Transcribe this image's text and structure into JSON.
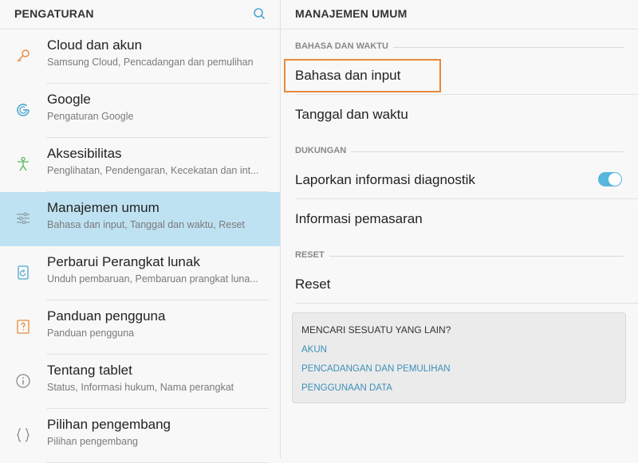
{
  "left_panel": {
    "title": "PENGATURAN",
    "search_icon": "search-icon",
    "items": [
      {
        "label": "Cloud dan akun",
        "sub": "Samsung Cloud, Pencadangan dan pemulihan",
        "icon": "key-icon"
      },
      {
        "label": "Google",
        "sub": "Pengaturan Google",
        "icon": "google-icon"
      },
      {
        "label": "Aksesibilitas",
        "sub": "Penglihatan, Pendengaran, Kecekatan dan int...",
        "icon": "accessibility-icon"
      },
      {
        "label": "Manajemen umum",
        "sub": "Bahasa dan input, Tanggal dan waktu, Reset",
        "icon": "sliders-icon",
        "active": true
      },
      {
        "label": "Perbarui Perangkat lunak",
        "sub": "Unduh pembaruan, Pembaruan prangkat luna...",
        "icon": "software-update-icon"
      },
      {
        "label": "Panduan pengguna",
        "sub": "Panduan pengguna",
        "icon": "help-book-icon"
      },
      {
        "label": "Tentang tablet",
        "sub": "Status, Informasi hukum, Nama perangkat",
        "icon": "info-icon"
      },
      {
        "label": "Pilihan pengembang",
        "sub": "Pilihan pengembang",
        "icon": "braces-icon"
      }
    ]
  },
  "right_panel": {
    "title": "MANAJEMEN UMUM",
    "sections": {
      "language_time": "BAHASA DAN WAKTU",
      "support": "DUKUNGAN",
      "reset": "RESET"
    },
    "items": {
      "language_input": "Bahasa dan input",
      "date_time": "Tanggal dan waktu",
      "report_diagnostic": "Laporkan informasi diagnostik",
      "marketing_info": "Informasi pemasaran",
      "reset": "Reset"
    },
    "diagnostic_toggle_on": true,
    "suggest_box": {
      "question": "MENCARI SESUATU YANG LAIN?",
      "links": [
        "AKUN",
        "PENCADANGAN DAN PEMULIHAN",
        "PENGGUNAAN DATA"
      ]
    }
  },
  "colors": {
    "accent": "#57b6dc",
    "active_bg": "#bfe2f2",
    "highlight": "#e8893a",
    "link": "#3d8fb8",
    "icon": "#e8893a"
  }
}
